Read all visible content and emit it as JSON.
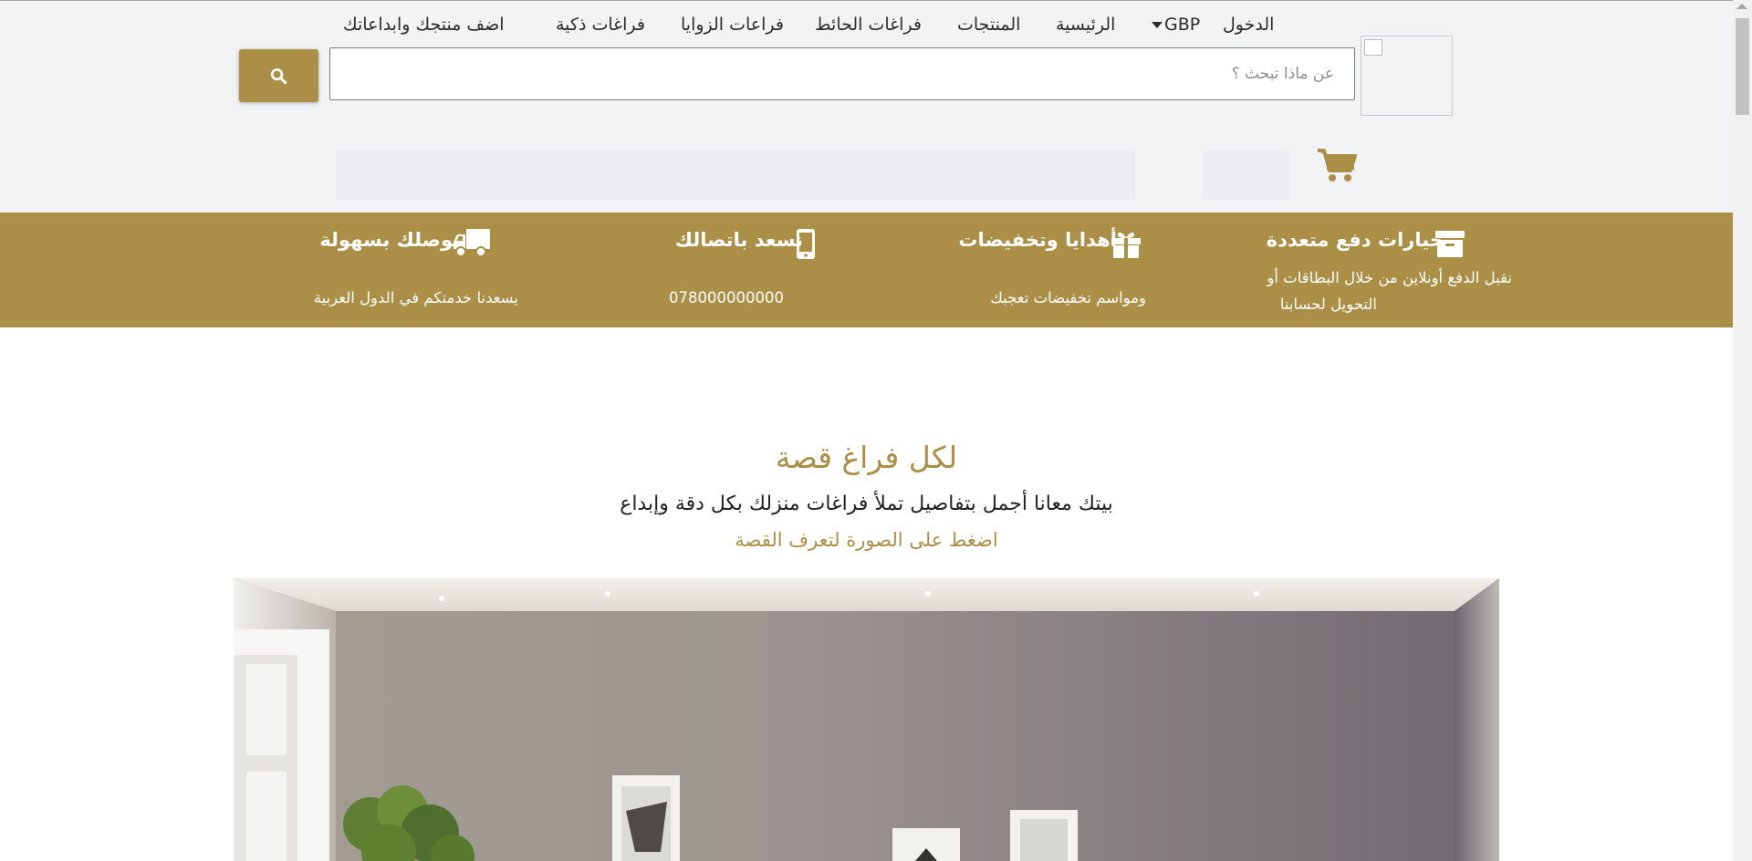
{
  "search": {
    "placeholder": "عن ماذا تبحث ؟",
    "button_icon": "search-icon"
  },
  "header": {
    "logo_icon": "broken-image-icon",
    "cart_icon": "shopping-cart-icon"
  },
  "nav": {
    "login": "الدخول",
    "currency": "GBP",
    "home": "الرئيسية",
    "products": "المنتجات",
    "wall_spaces": "فراغات الحائط",
    "corner_spaces": "فراعات الزوايا",
    "smart_spaces": "فراغات ذكية",
    "add_product": "اضف منتجك وابداعاتك"
  },
  "features": [
    {
      "title": "خيارات دفع متعددة",
      "desc_line1": "نقبل الدفع أونلاين من خلال البطاقات أو",
      "desc_line2": "التحويل لحسابنا",
      "icon": "archive-box-icon"
    },
    {
      "title": "أهدايا وتخفيضات",
      "desc_line1": "ومواسم تخفيضات تعجبك",
      "icon": "gift-icon"
    },
    {
      "title": "نسعد باتصالك",
      "desc_line1": "078000000000",
      "icon": "mobile-phone-icon"
    },
    {
      "title": "نوصلك بسهولة",
      "desc_line1": "يسعدنا خدمتكم في الدول العربية",
      "icon": "delivery-truck-icon"
    }
  ],
  "story": {
    "title": "لكل فراغ قصة",
    "subtitle": "بيتك معانا أجمل بتفاصيل تملأ فراغات منزلك بكل دقة وإبداع",
    "hint": "اضغط على الصورة لتعرف القصة"
  },
  "colors": {
    "brand_gold": "#ab8f46",
    "header_bg": "#f2f3f5"
  }
}
